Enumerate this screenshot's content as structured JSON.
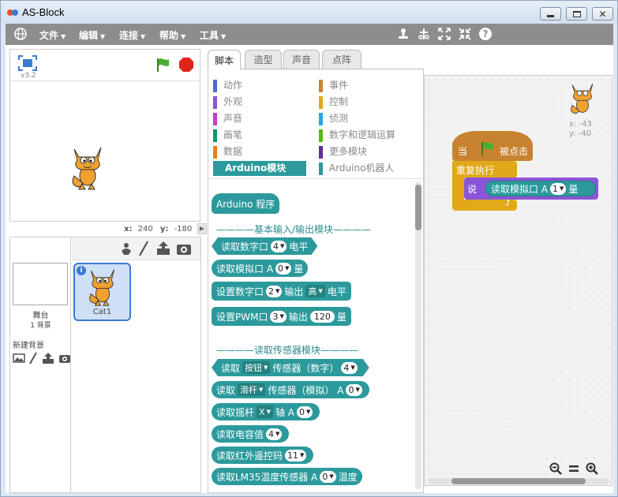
{
  "window": {
    "title": "AS-Block"
  },
  "menu": [
    {
      "label": "文件"
    },
    {
      "label": "编辑"
    },
    {
      "label": "连接"
    },
    {
      "label": "帮助"
    },
    {
      "label": "工具"
    }
  ],
  "stage": {
    "version": "v3.2",
    "coords": {
      "x_label": "x:",
      "x": "240",
      "y_label": "y:",
      "y": "-180"
    }
  },
  "sprites": {
    "stage_label": "舞台",
    "backdrops": "1 背景",
    "new_backdrop": "新建背景",
    "items": [
      {
        "name": "Cat1"
      }
    ]
  },
  "tabs": [
    {
      "label": "脚本"
    },
    {
      "label": "造型"
    },
    {
      "label": "声音"
    },
    {
      "label": "点阵"
    }
  ],
  "categories": {
    "left": [
      {
        "label": "动作",
        "color": "#4a6cd4"
      },
      {
        "label": "外观",
        "color": "#8a55d7"
      },
      {
        "label": "声音",
        "color": "#bb42c3"
      },
      {
        "label": "画笔",
        "color": "#0e9a6c"
      },
      {
        "label": "数据",
        "color": "#ee7d16"
      },
      {
        "label": "Arduino模块",
        "color": "#2c9a9c"
      }
    ],
    "right": [
      {
        "label": "事件",
        "color": "#c88330"
      },
      {
        "label": "控制",
        "color": "#e1a91a"
      },
      {
        "label": "侦测",
        "color": "#2ca5e2"
      },
      {
        "label": "数字和逻辑运算",
        "color": "#5cb712"
      },
      {
        "label": "更多模块",
        "color": "#632d99"
      },
      {
        "label": "Arduino机器人",
        "color": "#2c9a9c"
      }
    ]
  },
  "blocks": {
    "program": "Arduino 程序",
    "heading1": "————基本输入/输出模块————",
    "read_digital": {
      "label": "读取数字口",
      "port": "4",
      "suffix": "电平"
    },
    "read_analog": {
      "label": "读取模拟口 A",
      "port": "0",
      "suffix": "量"
    },
    "set_digital": {
      "label": "设置数字口",
      "port": "2",
      "mid": "输出",
      "level": "高",
      "suffix": "电平"
    },
    "set_pwm": {
      "label": "设置PWM口",
      "port": "3",
      "mid": "输出",
      "value": "120",
      "suffix": "量"
    },
    "heading2": "————读取传感器模块————",
    "read_button": {
      "label": "读取",
      "type": "按钮",
      "mid": "传感器（数字）",
      "port": "4"
    },
    "read_slider": {
      "label": "读取",
      "type": "滑杆",
      "mid": "传感器（模拟） A",
      "port": "0"
    },
    "read_joystick": {
      "label": "读取摇杆",
      "axis": "X",
      "mid": "轴 A",
      "port": "0"
    },
    "read_capacitance": {
      "label": "读取电容值",
      "port": "4"
    },
    "read_ir": {
      "label": "读取红外遥控码",
      "port": "11"
    },
    "read_lm35": {
      "label": "读取LM35温度传感器 A",
      "port": "0",
      "suffix": "温度"
    }
  },
  "script": {
    "sprite_x": "x: -43",
    "sprite_y": "y: -40",
    "hat": {
      "prefix": "当",
      "suffix": "被点击"
    },
    "loop": "重复执行",
    "say": "说",
    "reporter": {
      "label": "读取模拟口 A",
      "port": "1",
      "suffix": "量"
    }
  }
}
